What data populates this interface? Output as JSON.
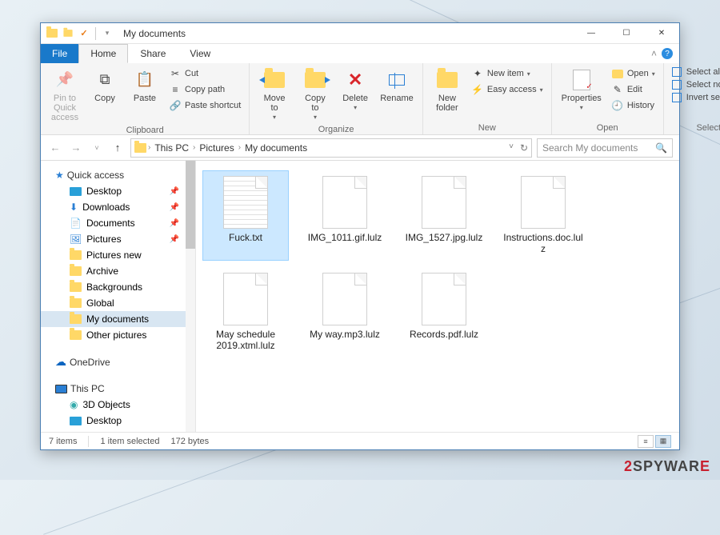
{
  "window": {
    "title": "My documents"
  },
  "tabs": {
    "file": "File",
    "home": "Home",
    "share": "Share",
    "view": "View"
  },
  "ribbon": {
    "clipboard": {
      "label": "Clipboard",
      "pin": "Pin to Quick access",
      "copy": "Copy",
      "paste": "Paste",
      "cut": "Cut",
      "copy_path": "Copy path",
      "paste_shortcut": "Paste shortcut"
    },
    "organize": {
      "label": "Organize",
      "move_to": "Move to",
      "copy_to": "Copy to",
      "delete": "Delete",
      "rename": "Rename"
    },
    "new": {
      "label": "New",
      "new_folder": "New folder",
      "new_item": "New item",
      "easy_access": "Easy access"
    },
    "open": {
      "label": "Open",
      "properties": "Properties",
      "open": "Open",
      "edit": "Edit",
      "history": "History"
    },
    "select": {
      "label": "Select",
      "select_all": "Select all",
      "select_none": "Select none",
      "invert": "Invert selection"
    }
  },
  "breadcrumb": {
    "root": "This PC",
    "p1": "Pictures",
    "p2": "My documents"
  },
  "search": {
    "placeholder": "Search My documents"
  },
  "sidebar": {
    "quick_access": "Quick access",
    "desktop": "Desktop",
    "downloads": "Downloads",
    "documents": "Documents",
    "pictures": "Pictures",
    "pictures_new": "Pictures new",
    "archive": "Archive",
    "backgrounds": "Backgrounds",
    "global": "Global",
    "my_documents": "My documents",
    "other_pictures": "Other pictures",
    "onedrive": "OneDrive",
    "this_pc": "This PC",
    "objects3d": "3D Objects",
    "desktop2": "Desktop"
  },
  "files": {
    "f0": "Fuck.txt",
    "f1": "IMG_1011.gif.lulz",
    "f2": "IMG_1527.jpg.lulz",
    "f3": "Instructions.doc.lulz",
    "f4": "May schedule 2019.xtml.lulz",
    "f5": "My way.mp3.lulz",
    "f6": "Records.pdf.lulz"
  },
  "status": {
    "count": "7 items",
    "selected": "1 item selected",
    "size": "172 bytes"
  },
  "watermark": {
    "two": "2",
    "spy": "SPYWAR",
    "e": "E"
  }
}
